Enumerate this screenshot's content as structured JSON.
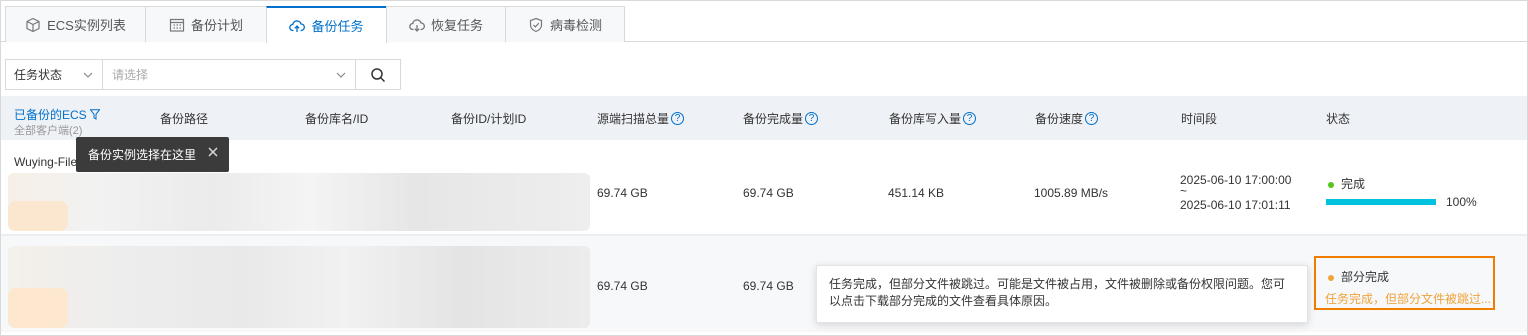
{
  "tabs": [
    {
      "label": "ECS实例列表",
      "icon": "cube-icon"
    },
    {
      "label": "备份计划",
      "icon": "calendar-icon"
    },
    {
      "label": "备份任务",
      "icon": "cloud-upload-icon",
      "active": true
    },
    {
      "label": "恢复任务",
      "icon": "cloud-download-icon"
    },
    {
      "label": "病毒检测",
      "icon": "shield-check-icon"
    }
  ],
  "filter": {
    "status_label": "任务状态",
    "placeholder": "请选择"
  },
  "table": {
    "first_header": "已备份的ECS",
    "first_header_sub": "全部客户端(2)",
    "headers": [
      "备份路径",
      "备份库名/ID",
      "备份ID/计划ID",
      "源端扫描总量",
      "备份完成量",
      "备份库写入量",
      "备份速度",
      "时间段",
      "状态"
    ],
    "rows": [
      {
        "ecs": "Wuying-File",
        "scan_total": "69.74 GB",
        "backup_done": "69.74 GB",
        "write_amount": "451.14 KB",
        "speed": "1005.89 MB/s",
        "time_start": "2025-06-10 17:00:00",
        "time_sep": "~",
        "time_end": "2025-06-10 17:01:11",
        "status": "完成",
        "progress": "100%"
      },
      {
        "scan_total": "69.74 GB",
        "backup_done": "69.74 GB",
        "status": "部分完成",
        "status_detail": "任务完成，但部分文件被跳过..."
      }
    ]
  },
  "tooltip_ecs": "备份实例选择在这里",
  "tooltip_partial": "任务完成，但部分文件被跳过。可能是文件被占用，文件被删除或备份权限问题。您可以点击下载部分完成的文件查看具体原因。",
  "colors": {
    "accent": "#0070cc",
    "success": "#52c41a",
    "warning": "#f0a33a",
    "highlight": "#f07c00",
    "progress": "#00c1de"
  }
}
